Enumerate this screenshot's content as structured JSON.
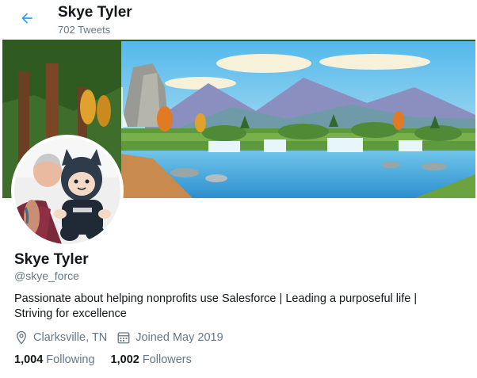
{
  "header": {
    "title": "Skye Tyler",
    "tweet_count": "702 Tweets",
    "back_icon": "arrow-left-icon"
  },
  "colors": {
    "accent": "#1da1f2",
    "text": "#14171a",
    "secondary": "#657786"
  },
  "profile": {
    "name": "Skye Tyler",
    "handle": "@skye_force",
    "bio_line1": "Passionate about helping nonprofits use Salesforce | Leading a purposeful life |",
    "bio_line2": "Striving for excellence",
    "location": "Clarksville, TN",
    "joined": "Joined May 2019",
    "location_icon": "map-pin-icon",
    "joined_icon": "calendar-icon"
  },
  "stats": {
    "following_count": "1,004",
    "following_label": "Following",
    "followers_count": "1,002",
    "followers_label": "Followers"
  }
}
